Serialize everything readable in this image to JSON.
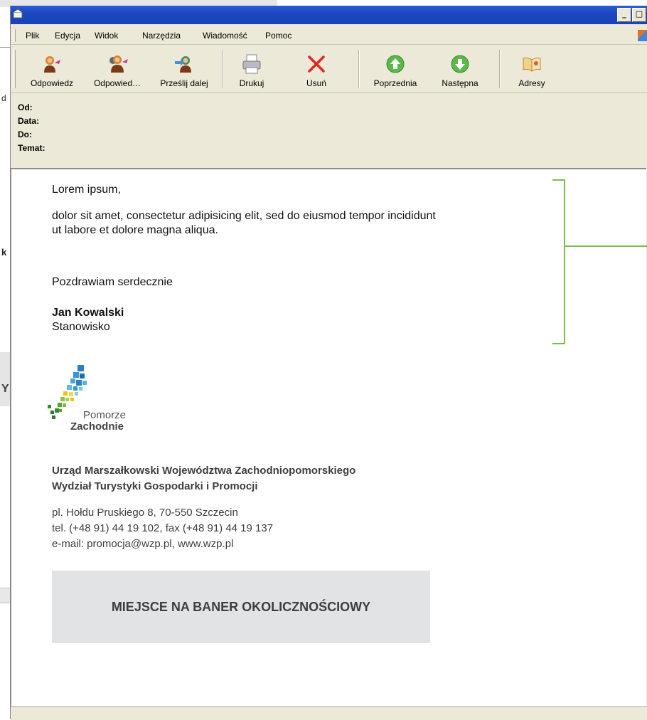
{
  "background": {
    "fragments": [
      "d",
      "k",
      "Y"
    ]
  },
  "window": {
    "title": "",
    "controls": [
      "_",
      "□"
    ]
  },
  "menu": [
    "Plik",
    "Edycja",
    "Widok",
    "Narzędzia",
    "Wiadomość",
    "Pomoc"
  ],
  "toolbar": {
    "reply": "Odpowiedz",
    "reply_all": "Odpowied…",
    "forward": "Prześlij dalej",
    "print": "Drukuj",
    "delete": "Usuń",
    "previous": "Poprzednia",
    "next": "Następna",
    "addresses": "Adresy"
  },
  "headers": {
    "from": "Od:",
    "date": "Data:",
    "to": "Do:",
    "subject": "Temat:"
  },
  "message": {
    "greeting": "Lorem ipsum,",
    "body_line1": "dolor sit amet, consectetur adipisicing elit, sed do eiusmod tempor incididunt",
    "body_line2": "ut labore et dolore magna aliqua.",
    "closing": "Pozdrawiam serdecznie",
    "name": "Jan Kowalski",
    "position": "Stanowisko"
  },
  "signature": {
    "logo_line1": "Pomorze",
    "logo_line2": "Zachodnie",
    "org_line1": "Urząd Marszałkowski Województwa Zachodniopomorskiego",
    "org_line2": "Wydział Turystyki Gospodarki i Promocji",
    "address": "pl. Hołdu Pruskiego 8, 70-550 Szczecin",
    "phone": "tel. (+48 91) 44 19 102, fax (+48 91) 44 19 137",
    "email": "e-mail: promocja@wzp.pl, www.wzp.pl",
    "banner": "MIEJSCE NA BANER OKOLICZNOŚCIOWY"
  },
  "colors": {
    "accent_green": "#7dbb42",
    "titlebar_blue": "#1b47c2",
    "banner_gray": "#e2e3e4"
  }
}
